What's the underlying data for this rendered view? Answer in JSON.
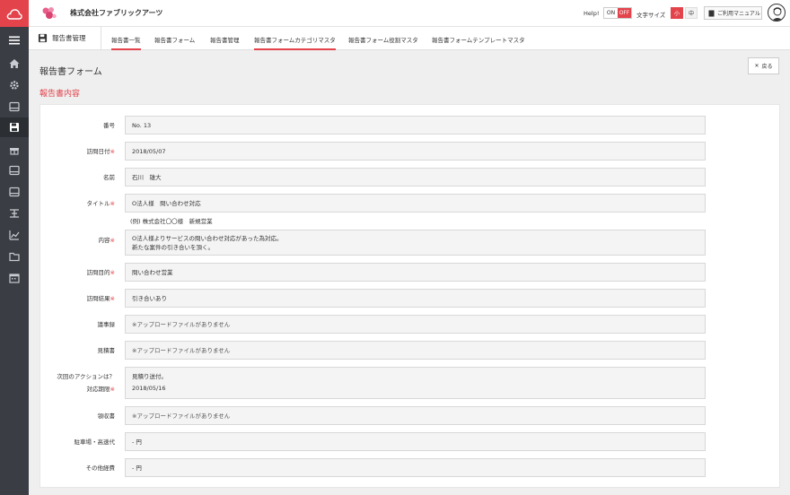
{
  "app": {
    "company": "株式会社ファブリックアーツ",
    "colors": {
      "accent": "#e3434b",
      "rail": "#3a3d44"
    }
  },
  "topbar": {
    "help_label": "Help!",
    "toggle_on": "ON",
    "toggle_off": "OFF",
    "fontsize_label": "文字サイズ",
    "fontsize_small": "小",
    "fontsize_mid": "中",
    "manual_label": "ご利用マニュアル"
  },
  "rail": {
    "icons": [
      "menu-icon",
      "home-icon",
      "gear-icon",
      "inbox-icon",
      "floppy-icon",
      "gift-icon",
      "inbox-icon",
      "inbox-icon",
      "branch-icon",
      "chart-icon",
      "folder-icon",
      "calendar-icon"
    ]
  },
  "subnav": {
    "title": "報告書管理",
    "tabs": [
      {
        "label": "報告書一覧",
        "active": true
      },
      {
        "label": "報告書フォーム",
        "active": false
      },
      {
        "label": "報告書管理",
        "active": false
      },
      {
        "label": "報告書フォームカテゴリマスタ",
        "active": true
      },
      {
        "label": "報告書フォーム役割マスタ",
        "active": false
      },
      {
        "label": "報告書フォームテンプレートマスタ",
        "active": false
      }
    ]
  },
  "page": {
    "title": "報告書フォーム",
    "back_label": "戻る",
    "section_title": "報告書内容"
  },
  "form": {
    "number": {
      "label": "番号",
      "value": "No. 13"
    },
    "visit_date": {
      "label": "訪問日付",
      "req": "※",
      "value": "2018/05/07"
    },
    "name": {
      "label": "名前",
      "value": "石川　雄大"
    },
    "title": {
      "label": "タイトル",
      "req": "※",
      "value": "O法人様　問い合わせ対応",
      "hint": "(例) 株式会社〇〇様　新規営業"
    },
    "content": {
      "label": "内容",
      "req": "※",
      "line1": "O法人様よりサービスの問い合わせ対応があった為対応。",
      "line2": "新たな案件の引き合いを頂く。"
    },
    "purpose": {
      "label": "訪問目的",
      "req": "※",
      "value": "問い合わせ営業"
    },
    "result": {
      "label": "訪問結果",
      "req": "※",
      "value": "引き合いあり"
    },
    "minutes": {
      "label": "議事録",
      "value": "※アップロードファイルがありません"
    },
    "estimate": {
      "label": "見積書",
      "value": "※アップロードファイルがありません"
    },
    "next_action": {
      "label": "次回のアクションは？",
      "deadline_label": "対応期限",
      "req": "※",
      "value": "見積り送付。",
      "deadline": "2018/05/16"
    },
    "receipt": {
      "label": "領収書",
      "value": "※アップロードファイルがありません"
    },
    "parking": {
      "label": "駐車場・高速代",
      "value": "- 円"
    },
    "other": {
      "label": "その他経費",
      "value": "- 円"
    }
  }
}
